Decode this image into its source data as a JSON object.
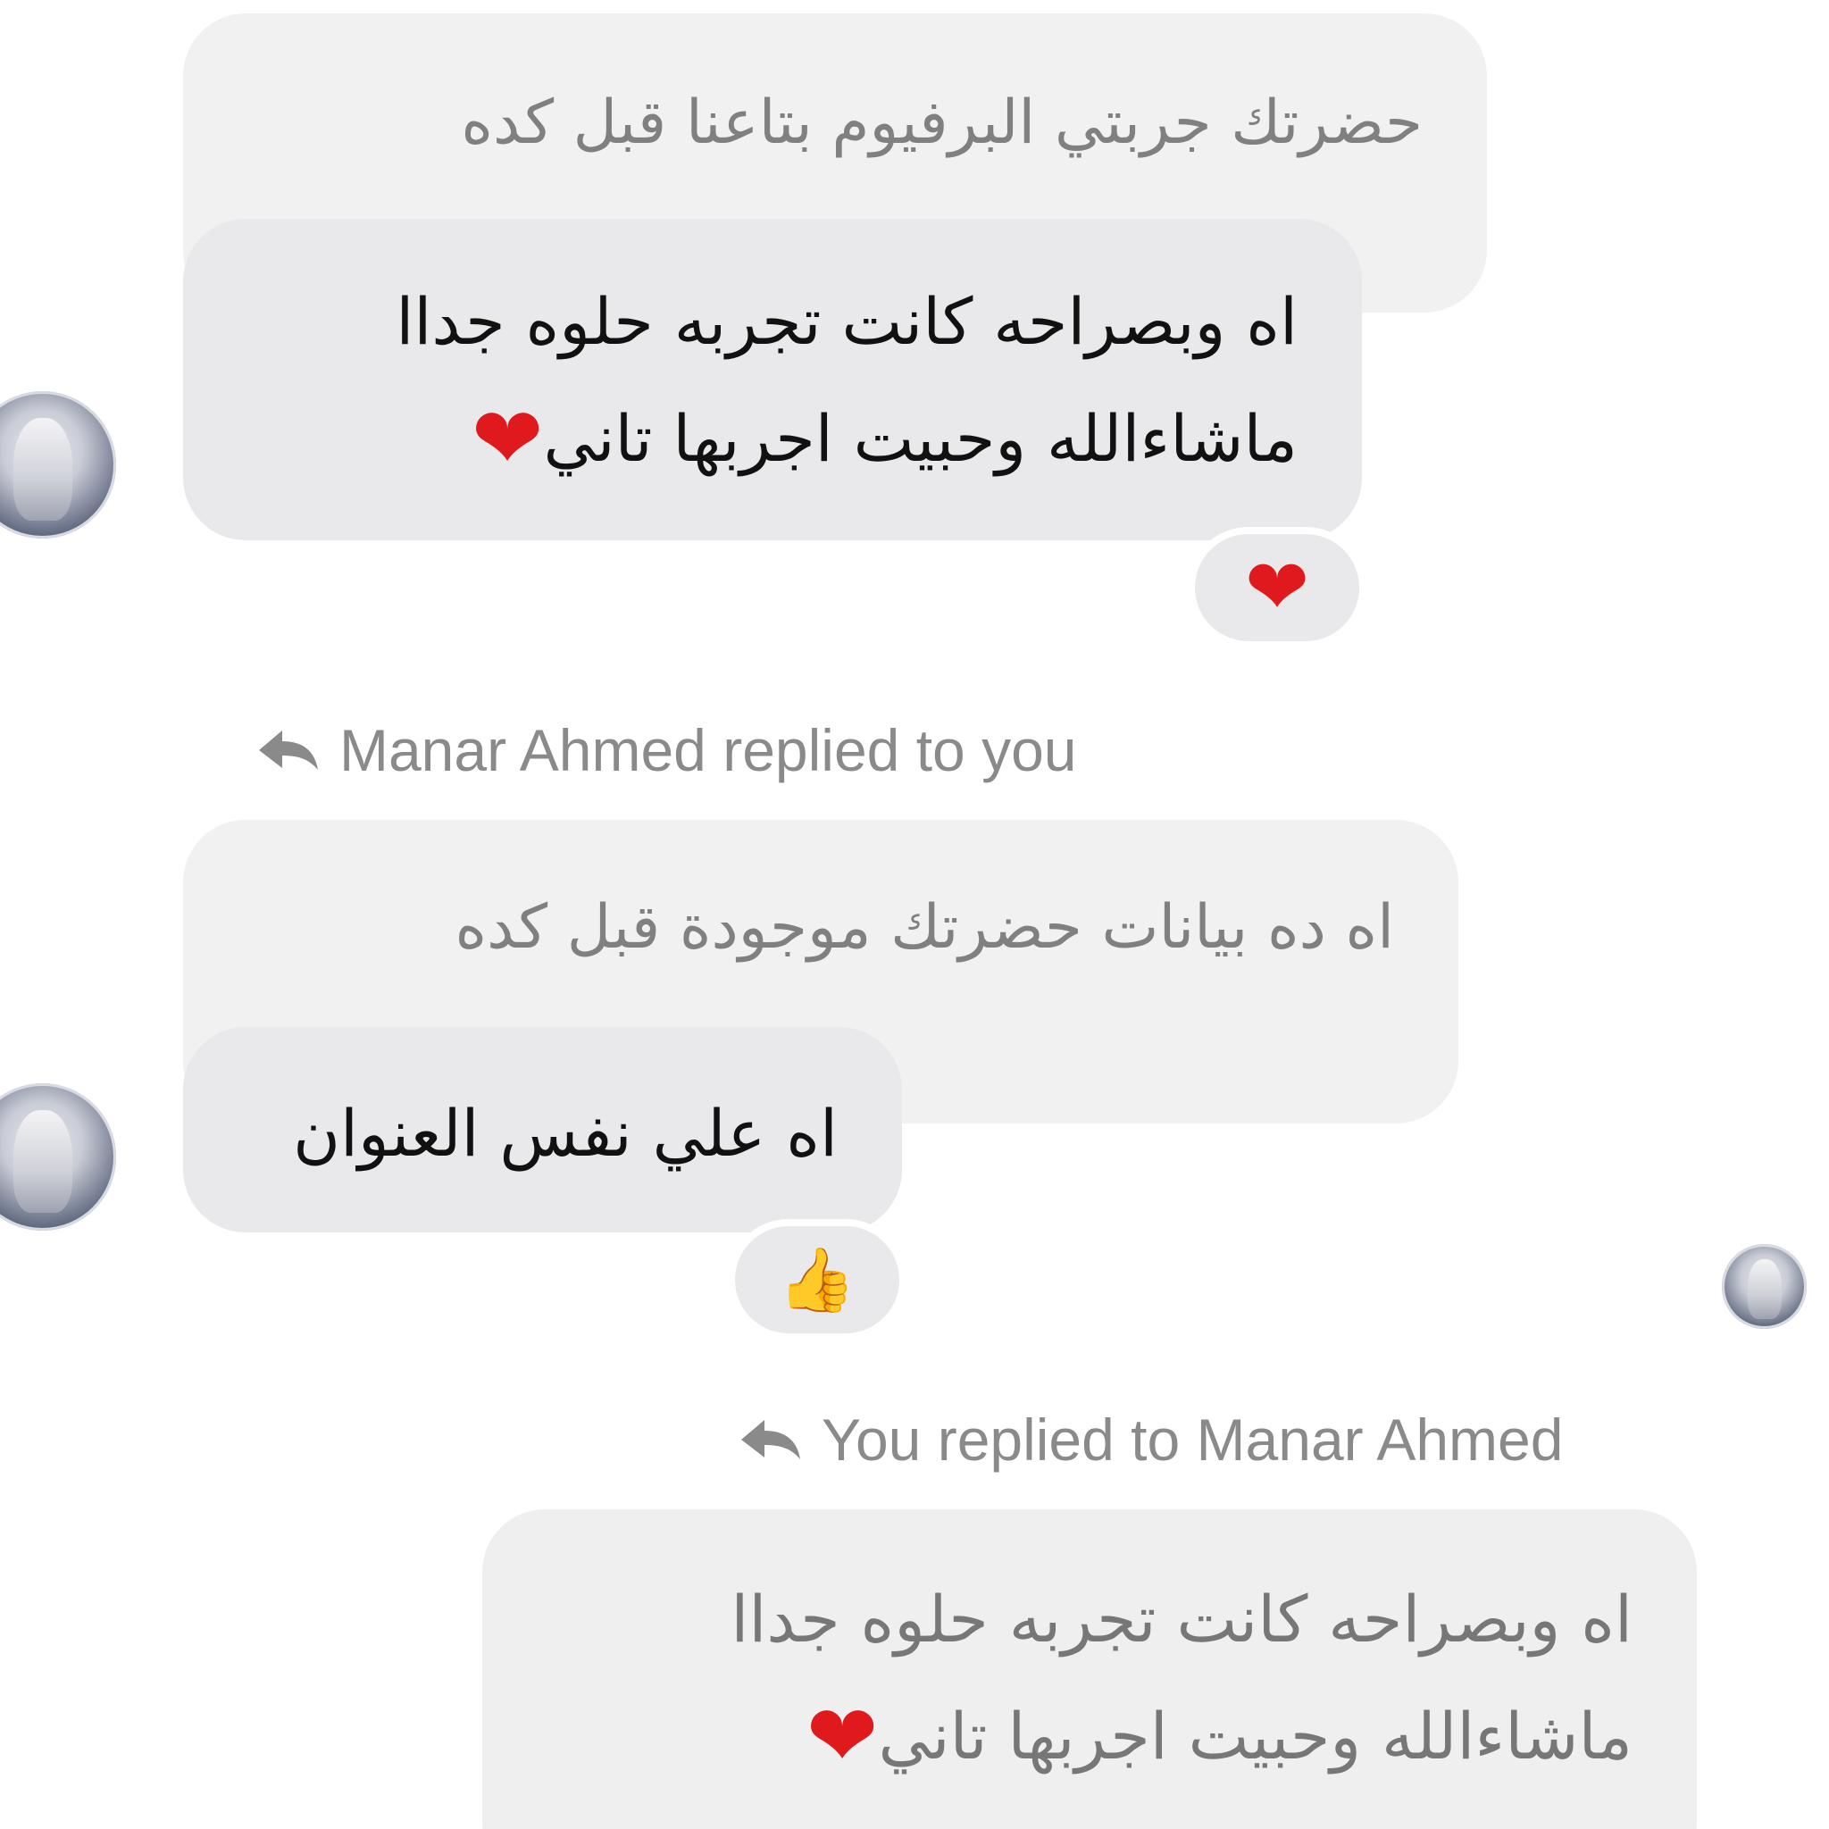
{
  "conversation": {
    "thread1": {
      "quoted_text": "حضرتك جربتي البرفيوم بتاعنا قبل كده",
      "message_line1": "اه وبصراحه كانت تجربه حلوه جداا",
      "message_line2": "ماشاءالله وحبيت اجربها تاني",
      "inline_emoji": "heart-emoji",
      "reaction": "heart-emoji"
    },
    "reply_notice_1": "Manar Ahmed replied to you",
    "thread2": {
      "quoted_text": "اه ده بيانات حضرتك موجودة قبل كده",
      "message": "اه علي نفس العنوان",
      "reaction": "thumbs-up-emoji"
    },
    "reply_notice_2": "You replied to Manar Ahmed",
    "thread3": {
      "quoted_line1": "اه وبصراحه كانت تجربه حلوه جداا",
      "quoted_line2": "ماشاءالله وحبيت اجربها تاني",
      "inline_emoji": "heart-emoji"
    }
  },
  "icons": {
    "reply": "reply-arrow-icon",
    "avatar": "user-avatar"
  },
  "colors": {
    "bubble_received": "#e9e9eb",
    "bubble_quoted": "#f1f1f2",
    "quoted_text": "#808080",
    "message_text": "#111111",
    "heart": "#e0191c",
    "reply_label": "#8a8a8a"
  }
}
